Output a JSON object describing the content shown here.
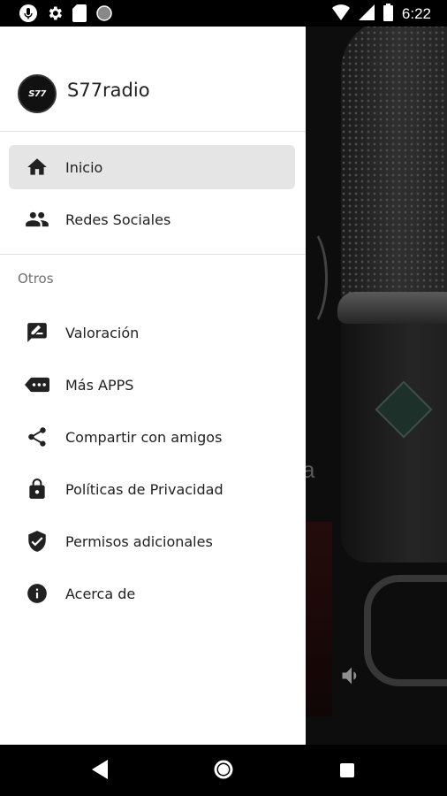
{
  "status_bar": {
    "time": "6:22"
  },
  "drawer": {
    "app_name": "S77radio",
    "logo_text": "S77",
    "items": [
      {
        "label": "Inicio",
        "icon": "home-icon",
        "active": true
      },
      {
        "label": "Redes Sociales",
        "icon": "people-icon",
        "active": false
      }
    ],
    "section_title": "Otros",
    "other_items": [
      {
        "label": "Valoración",
        "icon": "rate-review-icon"
      },
      {
        "label": "Más APPS",
        "icon": "more-apps-icon"
      },
      {
        "label": "Compartir con amigos",
        "icon": "share-icon"
      },
      {
        "label": "Políticas de Privacidad",
        "icon": "lock-icon"
      },
      {
        "label": "Permisos adicionales",
        "icon": "shield-check-icon"
      },
      {
        "label": "Acerca de",
        "icon": "info-icon"
      }
    ]
  },
  "background": {
    "partial_text": "a"
  },
  "colors": {
    "active_bg": "#e5e5e5",
    "icon": "#212121",
    "section_title": "#707070"
  }
}
